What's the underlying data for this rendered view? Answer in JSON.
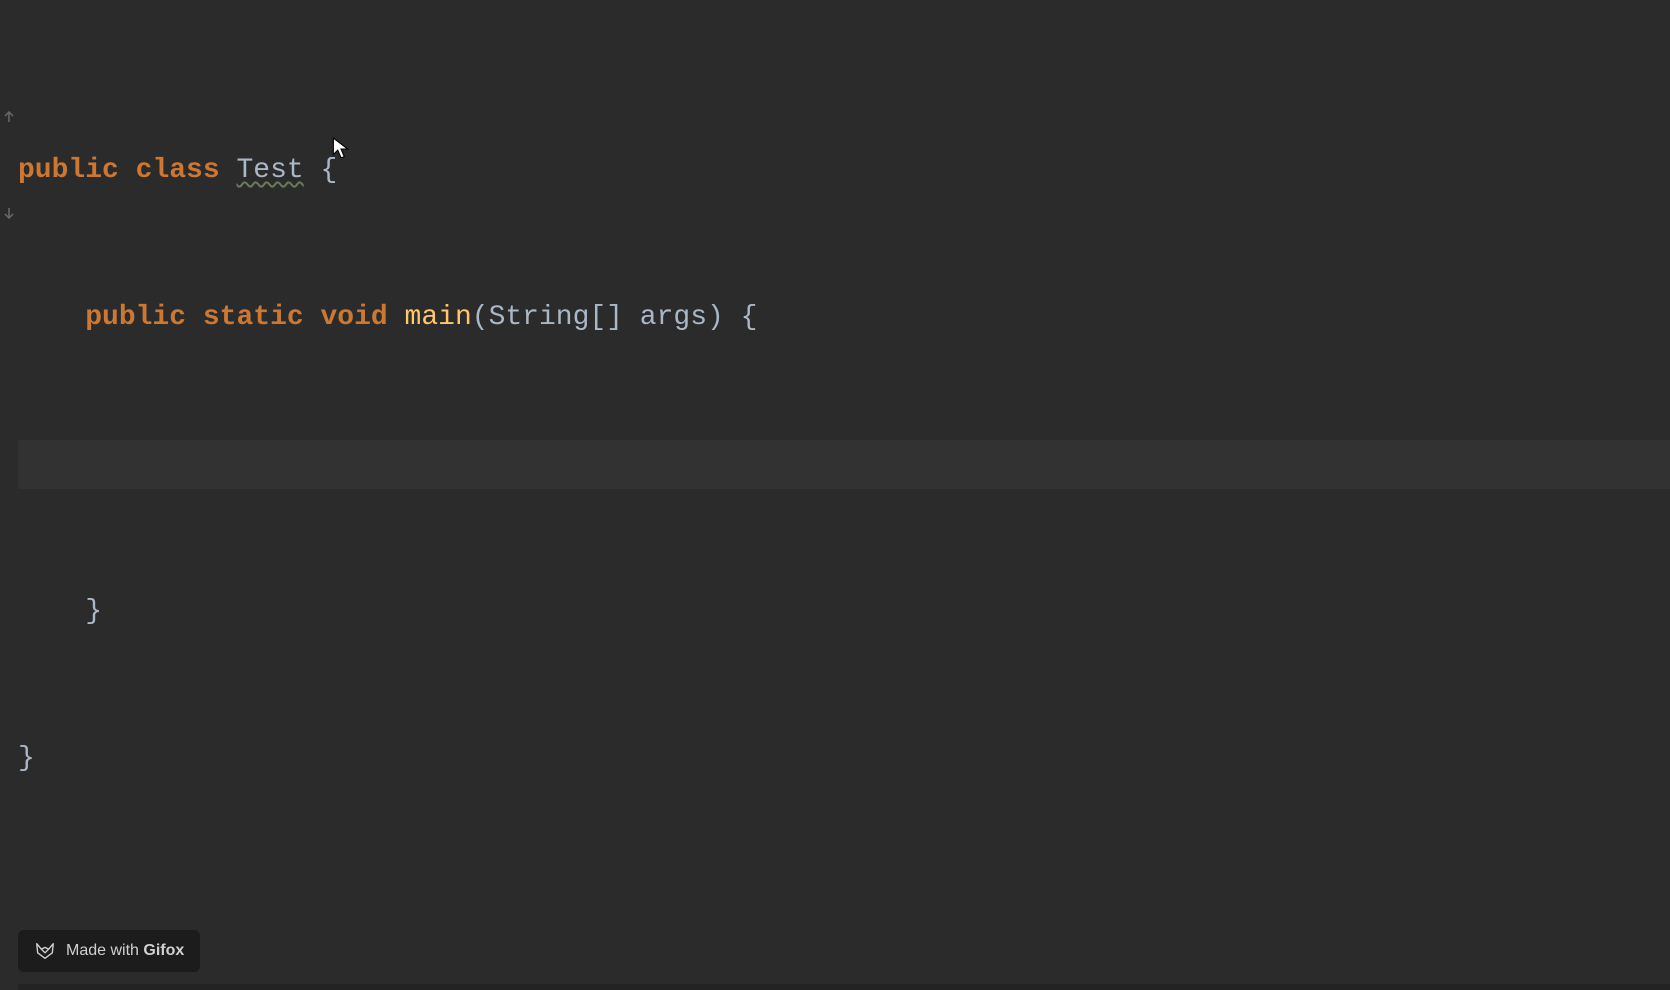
{
  "code": {
    "line1": {
      "kw_public": "public",
      "kw_class": "class",
      "classname": "Test",
      "brace_open": "{"
    },
    "line2": {
      "kw_public": "public",
      "kw_static": "static",
      "kw_void": "void",
      "method": "main",
      "paren_open": "(",
      "type": "String[]",
      "param": "args",
      "paren_close": ")",
      "brace_open": "{"
    },
    "line3": {
      "content": ""
    },
    "line4": {
      "brace_close": "}"
    },
    "line5": {
      "brace_close": "}"
    }
  },
  "watermark": {
    "prefix": "Made with ",
    "brand": "Gifox"
  }
}
